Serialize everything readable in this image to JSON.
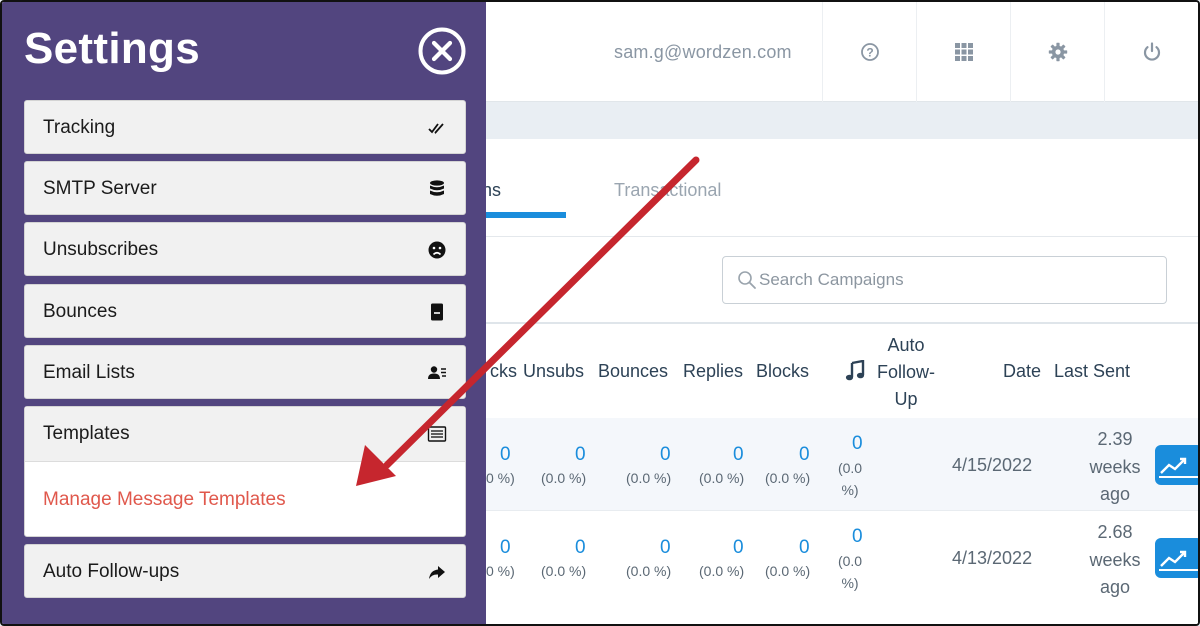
{
  "header": {
    "user_email": "sam.g@wordzen.com",
    "icons": [
      "help-icon",
      "apps-grid-icon",
      "settings-gear-icon",
      "power-icon"
    ]
  },
  "tabs": [
    {
      "label": "Campaigns",
      "visible_text": "igns",
      "active": true
    },
    {
      "label": "Transactional",
      "visible_text": "Transactional",
      "active": false
    }
  ],
  "search": {
    "placeholder": "Search Campaigns"
  },
  "table": {
    "columns": [
      "cks",
      "Unsubs",
      "Bounces",
      "Replies",
      "Blocks",
      "Auto Follow-Up",
      "Date",
      "Last Sent"
    ],
    "autofu_lines": [
      "Auto",
      "Follow-",
      "Up"
    ],
    "rows": [
      {
        "clicks": "0",
        "clicks_pct": "0 %)",
        "unsubs": "0",
        "unsubs_pct": "(0.0 %)",
        "bounces": "0",
        "bounces_pct": "(0.0 %)",
        "replies": "0",
        "replies_pct": "(0.0 %)",
        "blocks": "0",
        "blocks_pct": "(0.0 %)",
        "autofu": "0",
        "autofu_pct_1": "(0.0",
        "autofu_pct_2": "%)",
        "date": "4/15/2022",
        "last_sent": [
          "2.39",
          "weeks",
          "ago"
        ]
      },
      {
        "clicks": "0",
        "clicks_pct": "0 %)",
        "unsubs": "0",
        "unsubs_pct": "(0.0 %)",
        "bounces": "0",
        "bounces_pct": "(0.0 %)",
        "replies": "0",
        "replies_pct": "(0.0 %)",
        "blocks": "0",
        "blocks_pct": "(0.0 %)",
        "autofu": "0",
        "autofu_pct_1": "(0.0",
        "autofu_pct_2": "%)",
        "date": "4/13/2022",
        "last_sent": [
          "2.68",
          "weeks",
          "ago"
        ]
      }
    ]
  },
  "settings_panel": {
    "title": "Settings",
    "items": [
      {
        "label": "Tracking",
        "icon": "double-check-icon"
      },
      {
        "label": "SMTP Server",
        "icon": "database-icon"
      },
      {
        "label": "Unsubscribes",
        "icon": "sad-face-icon"
      },
      {
        "label": "Bounces",
        "icon": "bounce-icon"
      },
      {
        "label": "Email Lists",
        "icon": "contacts-list-icon"
      },
      {
        "label": "Templates",
        "icon": "template-list-icon",
        "expanded": true,
        "sub_items": [
          "Manage Message Templates"
        ]
      },
      {
        "label": "Auto Follow-ups",
        "icon": "share-arrow-icon"
      }
    ]
  },
  "colors": {
    "panel_bg": "#52457f",
    "accent_blue": "#1a8ddc",
    "link_red": "#e0584c",
    "annotation_arrow": "#c6262e"
  }
}
